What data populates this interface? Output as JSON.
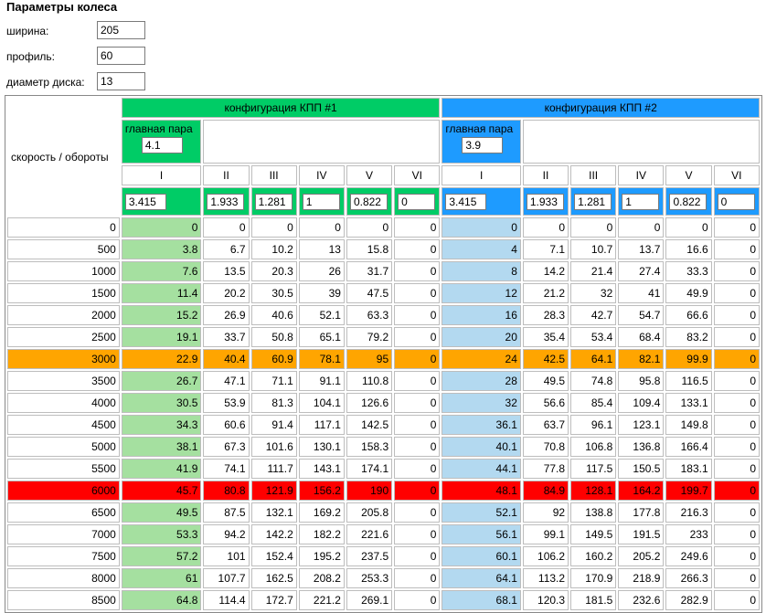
{
  "params": {
    "title": "Параметры колеса",
    "width_label": "ширина:",
    "width_value": "205",
    "profile_label": "профиль:",
    "profile_value": "60",
    "diameter_label": "диаметр диска:",
    "diameter_value": "13"
  },
  "table": {
    "corner_label": "скорость / обороты",
    "main_pair_label": "главная пара",
    "gear_labels": [
      "I",
      "II",
      "III",
      "IV",
      "V",
      "VI"
    ],
    "config1": {
      "title": "конфигурация КПП #1",
      "main_pair": "4.1",
      "ratios": [
        "3.415",
        "1.933",
        "1.281",
        "1",
        "0.822",
        "0"
      ]
    },
    "config2": {
      "title": "конфигурация КПП #2",
      "main_pair": "3.9",
      "ratios": [
        "3.415",
        "1.933",
        "1.281",
        "1",
        "0.822",
        "0"
      ]
    },
    "rows": [
      {
        "rpm": "0",
        "c1": [
          "0",
          "0",
          "0",
          "0",
          "0",
          "0"
        ],
        "c2": [
          "0",
          "0",
          "0",
          "0",
          "0",
          "0"
        ]
      },
      {
        "rpm": "500",
        "c1": [
          "3.8",
          "6.7",
          "10.2",
          "13",
          "15.8",
          "0"
        ],
        "c2": [
          "4",
          "7.1",
          "10.7",
          "13.7",
          "16.6",
          "0"
        ]
      },
      {
        "rpm": "1000",
        "c1": [
          "7.6",
          "13.5",
          "20.3",
          "26",
          "31.7",
          "0"
        ],
        "c2": [
          "8",
          "14.2",
          "21.4",
          "27.4",
          "33.3",
          "0"
        ]
      },
      {
        "rpm": "1500",
        "c1": [
          "11.4",
          "20.2",
          "30.5",
          "39",
          "47.5",
          "0"
        ],
        "c2": [
          "12",
          "21.2",
          "32",
          "41",
          "49.9",
          "0"
        ]
      },
      {
        "rpm": "2000",
        "c1": [
          "15.2",
          "26.9",
          "40.6",
          "52.1",
          "63.3",
          "0"
        ],
        "c2": [
          "16",
          "28.3",
          "42.7",
          "54.7",
          "66.6",
          "0"
        ]
      },
      {
        "rpm": "2500",
        "c1": [
          "19.1",
          "33.7",
          "50.8",
          "65.1",
          "79.2",
          "0"
        ],
        "c2": [
          "20",
          "35.4",
          "53.4",
          "68.4",
          "83.2",
          "0"
        ]
      },
      {
        "rpm": "3000",
        "c1": [
          "22.9",
          "40.4",
          "60.9",
          "78.1",
          "95",
          "0"
        ],
        "c2": [
          "24",
          "42.5",
          "64.1",
          "82.1",
          "99.9",
          "0"
        ],
        "highlight": "orange"
      },
      {
        "rpm": "3500",
        "c1": [
          "26.7",
          "47.1",
          "71.1",
          "91.1",
          "110.8",
          "0"
        ],
        "c2": [
          "28",
          "49.5",
          "74.8",
          "95.8",
          "116.5",
          "0"
        ]
      },
      {
        "rpm": "4000",
        "c1": [
          "30.5",
          "53.9",
          "81.3",
          "104.1",
          "126.6",
          "0"
        ],
        "c2": [
          "32",
          "56.6",
          "85.4",
          "109.4",
          "133.1",
          "0"
        ]
      },
      {
        "rpm": "4500",
        "c1": [
          "34.3",
          "60.6",
          "91.4",
          "117.1",
          "142.5",
          "0"
        ],
        "c2": [
          "36.1",
          "63.7",
          "96.1",
          "123.1",
          "149.8",
          "0"
        ]
      },
      {
        "rpm": "5000",
        "c1": [
          "38.1",
          "67.3",
          "101.6",
          "130.1",
          "158.3",
          "0"
        ],
        "c2": [
          "40.1",
          "70.8",
          "106.8",
          "136.8",
          "166.4",
          "0"
        ]
      },
      {
        "rpm": "5500",
        "c1": [
          "41.9",
          "74.1",
          "111.7",
          "143.1",
          "174.1",
          "0"
        ],
        "c2": [
          "44.1",
          "77.8",
          "117.5",
          "150.5",
          "183.1",
          "0"
        ]
      },
      {
        "rpm": "6000",
        "c1": [
          "45.7",
          "80.8",
          "121.9",
          "156.2",
          "190",
          "0"
        ],
        "c2": [
          "48.1",
          "84.9",
          "128.1",
          "164.2",
          "199.7",
          "0"
        ],
        "highlight": "red"
      },
      {
        "rpm": "6500",
        "c1": [
          "49.5",
          "87.5",
          "132.1",
          "169.2",
          "205.8",
          "0"
        ],
        "c2": [
          "52.1",
          "92",
          "138.8",
          "177.8",
          "216.3",
          "0"
        ]
      },
      {
        "rpm": "7000",
        "c1": [
          "53.3",
          "94.2",
          "142.2",
          "182.2",
          "221.6",
          "0"
        ],
        "c2": [
          "56.1",
          "99.1",
          "149.5",
          "191.5",
          "233",
          "0"
        ]
      },
      {
        "rpm": "7500",
        "c1": [
          "57.2",
          "101",
          "152.4",
          "195.2",
          "237.5",
          "0"
        ],
        "c2": [
          "60.1",
          "106.2",
          "160.2",
          "205.2",
          "249.6",
          "0"
        ]
      },
      {
        "rpm": "8000",
        "c1": [
          "61",
          "107.7",
          "162.5",
          "208.2",
          "253.3",
          "0"
        ],
        "c2": [
          "64.1",
          "113.2",
          "170.9",
          "218.9",
          "266.3",
          "0"
        ]
      },
      {
        "rpm": "8500",
        "c1": [
          "64.8",
          "114.4",
          "172.7",
          "221.2",
          "269.1",
          "0"
        ],
        "c2": [
          "68.1",
          "120.3",
          "181.5",
          "232.6",
          "282.9",
          "0"
        ]
      }
    ]
  },
  "colors": {
    "config1_header": "#00cc66",
    "config2_header": "#1e9bff",
    "config1_first_gear_column": "#a5e0a0",
    "config2_first_gear_column": "#b3d9f0",
    "highlight_orange": "#ffa500",
    "highlight_red": "#ff0000"
  }
}
